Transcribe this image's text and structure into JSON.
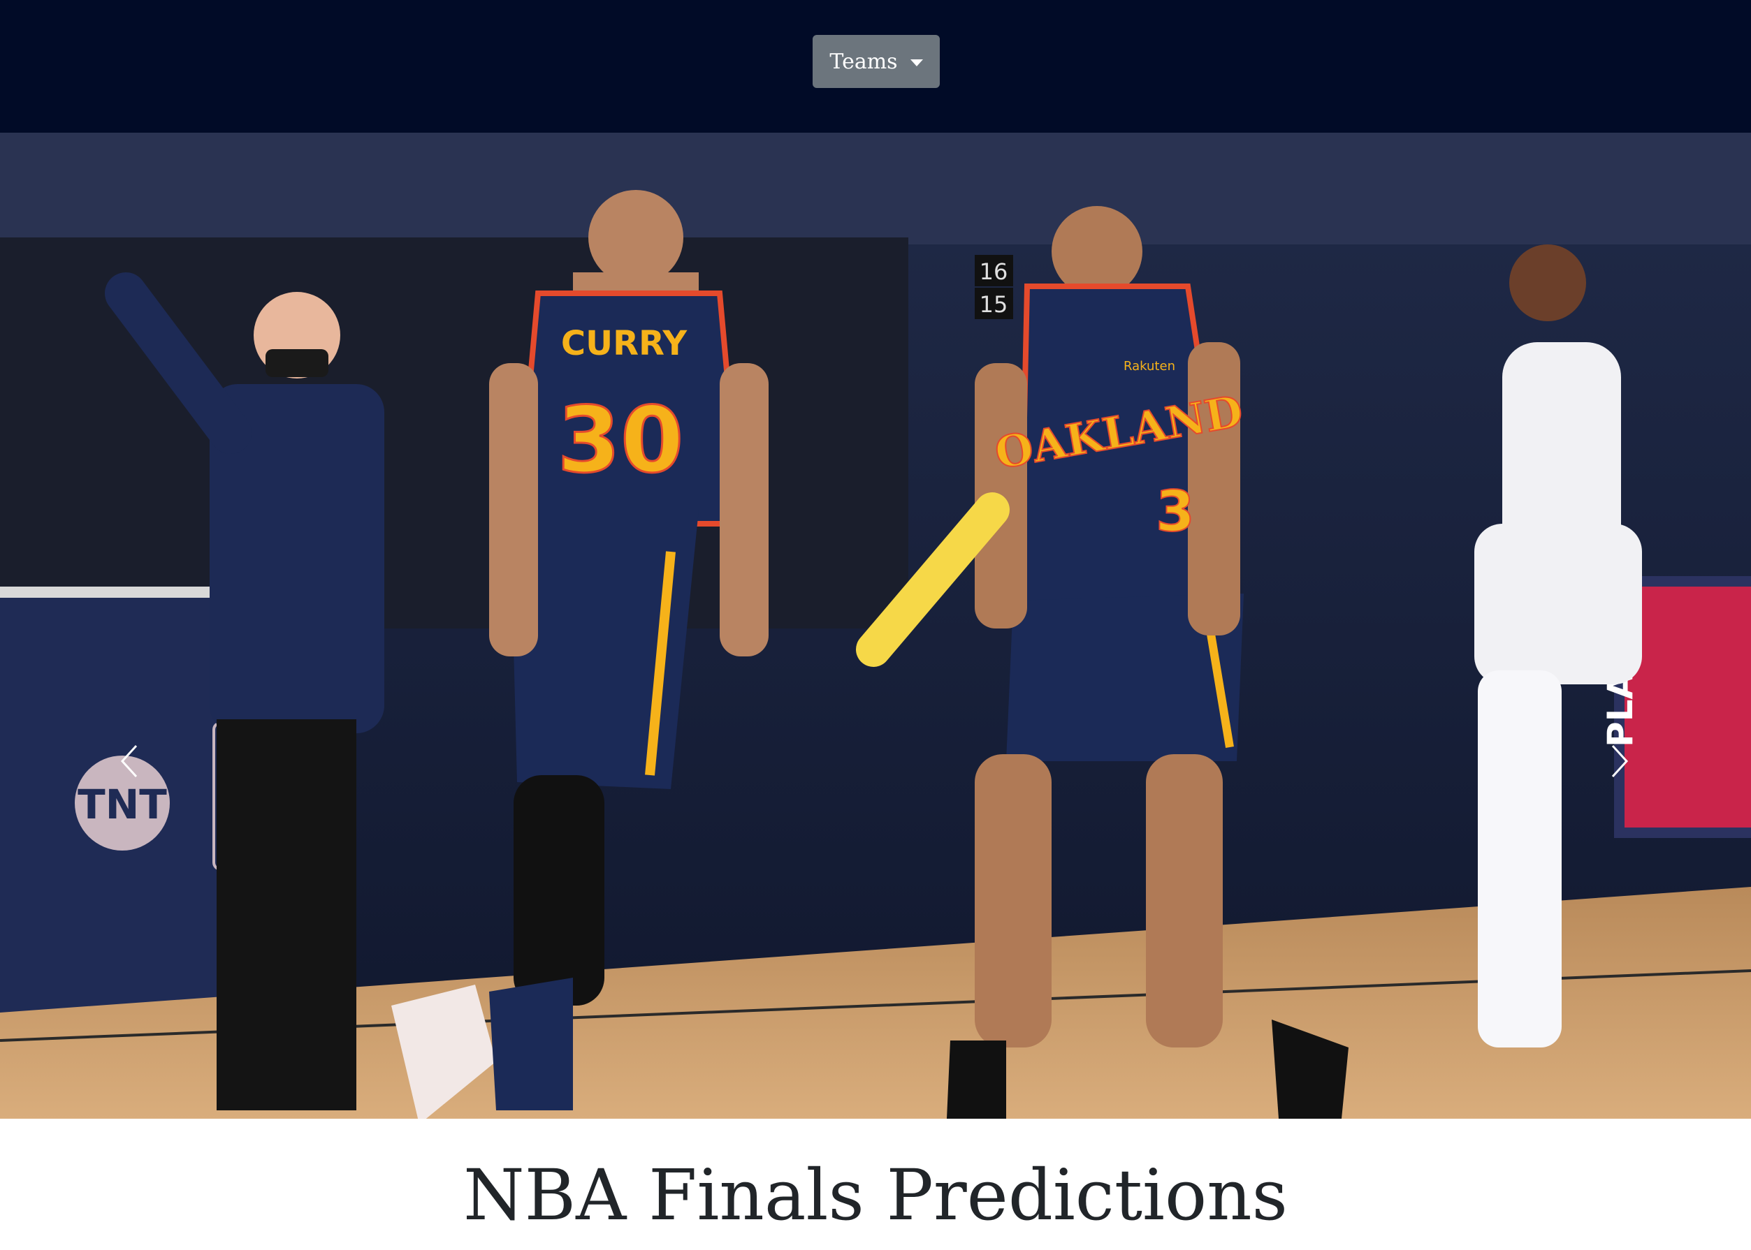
{
  "navbar": {
    "teams_button": {
      "label": "Teams"
    }
  },
  "carousel": {
    "slide": {
      "players": [
        {
          "name": "CURRY",
          "number": "30"
        },
        {
          "team": "OAKLAND",
          "number": "3",
          "sponsor": "Rakuten"
        }
      ],
      "signage": {
        "network": "TNT",
        "banner": "PLAYOFFS",
        "row_numbers": [
          "16",
          "15"
        ]
      }
    },
    "controls": {
      "prev_icon": "chevron-left-icon",
      "next_icon": "chevron-right-icon"
    }
  },
  "main": {
    "heading": "NBA Finals Predictions"
  },
  "colors": {
    "navbar_bg": "#010b27",
    "button_bg": "#6c757d",
    "jersey_navy": "#1b2a57",
    "jersey_gold": "#f6b21a",
    "jersey_red": "#e54a2c"
  }
}
